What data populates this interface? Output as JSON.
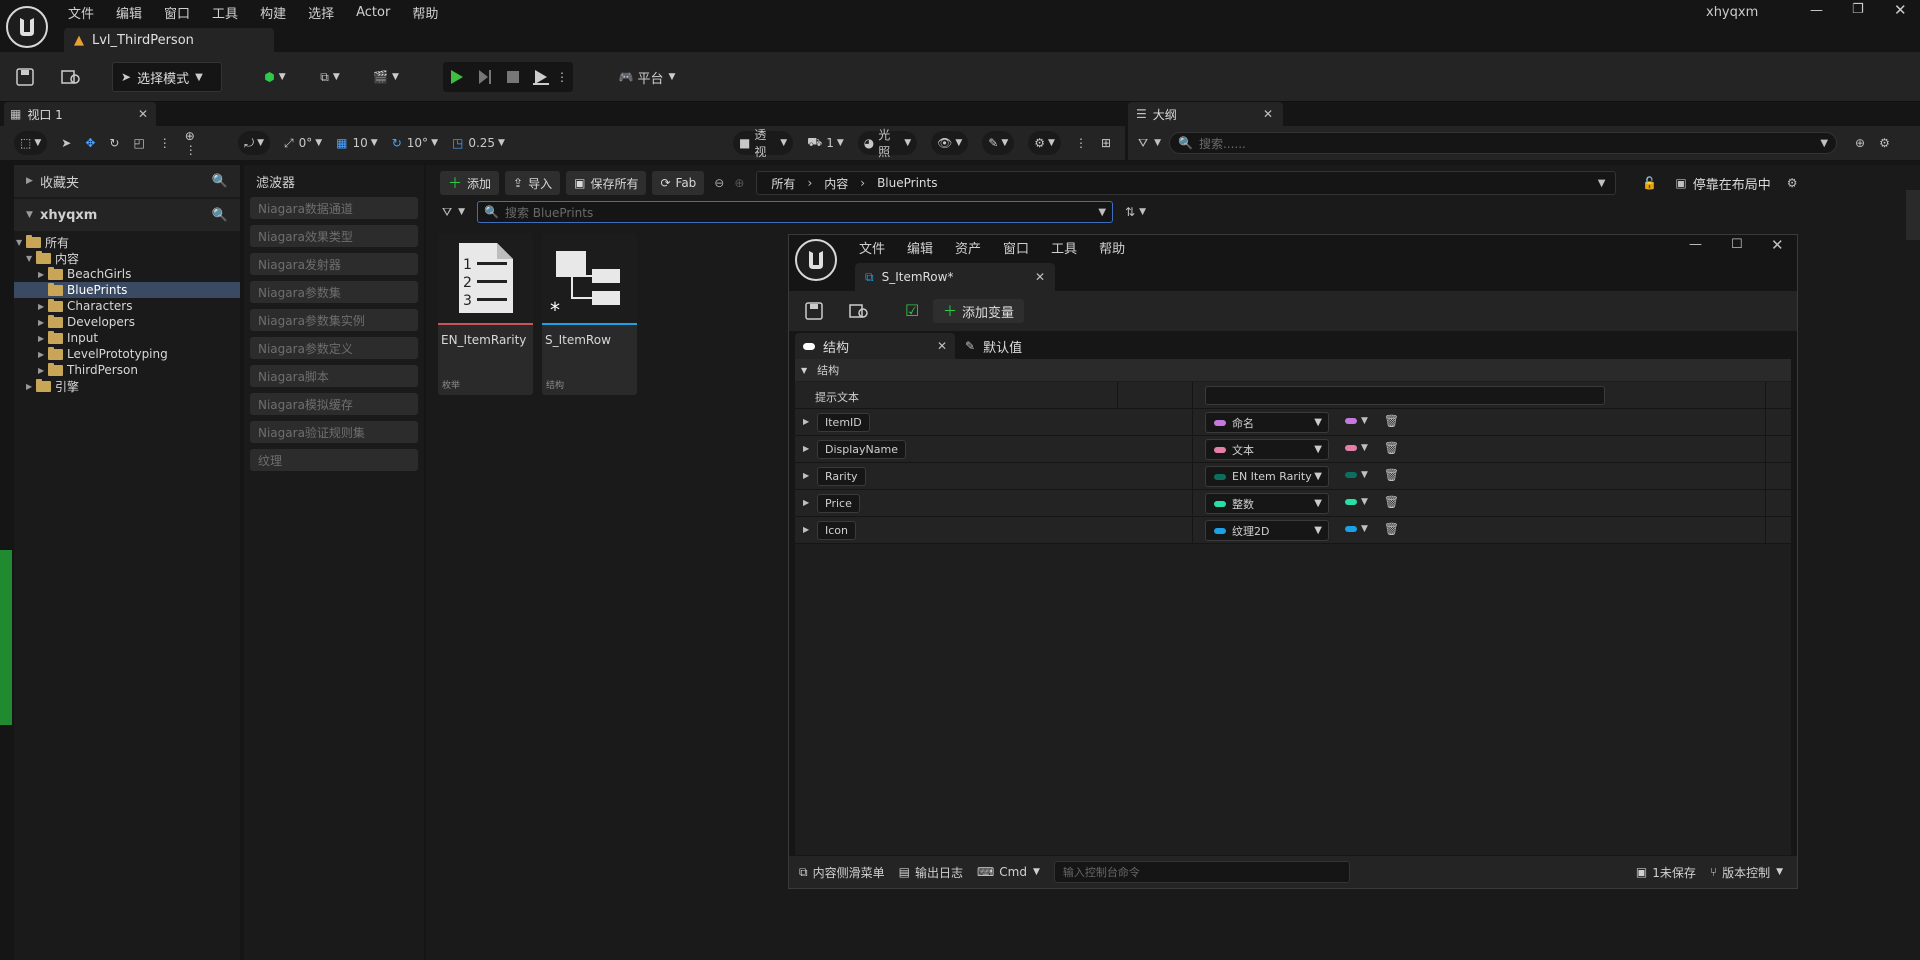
{
  "app": {
    "menu": [
      "文件",
      "编辑",
      "窗口",
      "工具",
      "构建",
      "选择",
      "Actor",
      "帮助"
    ],
    "user": "xhyqxm",
    "level_tab": "Lvl_ThirdPerson"
  },
  "toolbar": {
    "mode_label": "选择模式",
    "platform_label": "平台"
  },
  "viewport": {
    "tab_label": "视口 1",
    "rot_snap": "0°",
    "grid_snap": "10",
    "angle_snap": "10°",
    "scale_snap": "0.25",
    "perspective": "透视",
    "lighting": "光照",
    "camera_speed": "1"
  },
  "outliner": {
    "tab_label": "大纲",
    "search_placeholder": "搜索......"
  },
  "left_panel": {
    "favorites": "收藏夹",
    "project": "xhyqxm",
    "tree": [
      {
        "label": "所有",
        "depth": 0,
        "open": true
      },
      {
        "label": "内容",
        "depth": 1,
        "open": true
      },
      {
        "label": "BeachGirls",
        "depth": 2,
        "open": false
      },
      {
        "label": "BluePrints",
        "depth": 2,
        "open": false,
        "selected": true
      },
      {
        "label": "Characters",
        "depth": 2,
        "open": false
      },
      {
        "label": "Developers",
        "depth": 2,
        "open": false
      },
      {
        "label": "Input",
        "depth": 2,
        "open": false
      },
      {
        "label": "LevelPrototyping",
        "depth": 2,
        "open": false
      },
      {
        "label": "ThirdPerson",
        "depth": 2,
        "open": false
      },
      {
        "label": "引擎",
        "depth": 1,
        "open": false
      }
    ]
  },
  "filters": {
    "title": "滤波器",
    "items": [
      "Niagara数据通道",
      "Niagara效果类型",
      "Niagara发射器",
      "Niagara参数集",
      "Niagara参数集实例",
      "Niagara参数定义",
      "Niagara脚本",
      "Niagara模拟缓存",
      "Niagara验证规则集",
      "纹理"
    ]
  },
  "content_browser": {
    "add": "添加",
    "import": "导入",
    "save_all": "保存所有",
    "fab": "Fab",
    "breadcrumb": [
      "所有",
      "内容",
      "BluePrints"
    ],
    "dock": "停靠在布局中",
    "search_placeholder": "搜索 BluePrints",
    "assets": [
      {
        "name": "EN_ItemRarity",
        "type": "枚举"
      },
      {
        "name": "S_ItemRow",
        "type": "结构"
      }
    ]
  },
  "struct_editor": {
    "menu": [
      "文件",
      "编辑",
      "资产",
      "窗口",
      "工具",
      "帮助"
    ],
    "tab_title": "S_ItemRow*",
    "add_variable": "添加变量",
    "tab_structure": "结构",
    "tab_defaults": "默认值",
    "section": "结构",
    "tooltip_label": "提示文本",
    "fields": [
      {
        "name": "ItemID",
        "type": "命名",
        "color": "#c678dd"
      },
      {
        "name": "DisplayName",
        "type": "文本",
        "color": "#e57fa8"
      },
      {
        "name": "Rarity",
        "type": "EN Item Rarity",
        "color": "#0d6e5e"
      },
      {
        "name": "Price",
        "type": "整数",
        "color": "#27e0a8"
      },
      {
        "name": "Icon",
        "type": "纹理2D",
        "color": "#1ba1e6"
      }
    ],
    "status": {
      "drawer": "内容侧滑菜单",
      "output_log": "输出日志",
      "cmd": "Cmd",
      "console_placeholder": "输入控制台命令",
      "unsaved": "1未保存",
      "source_control": "版本控制"
    }
  }
}
